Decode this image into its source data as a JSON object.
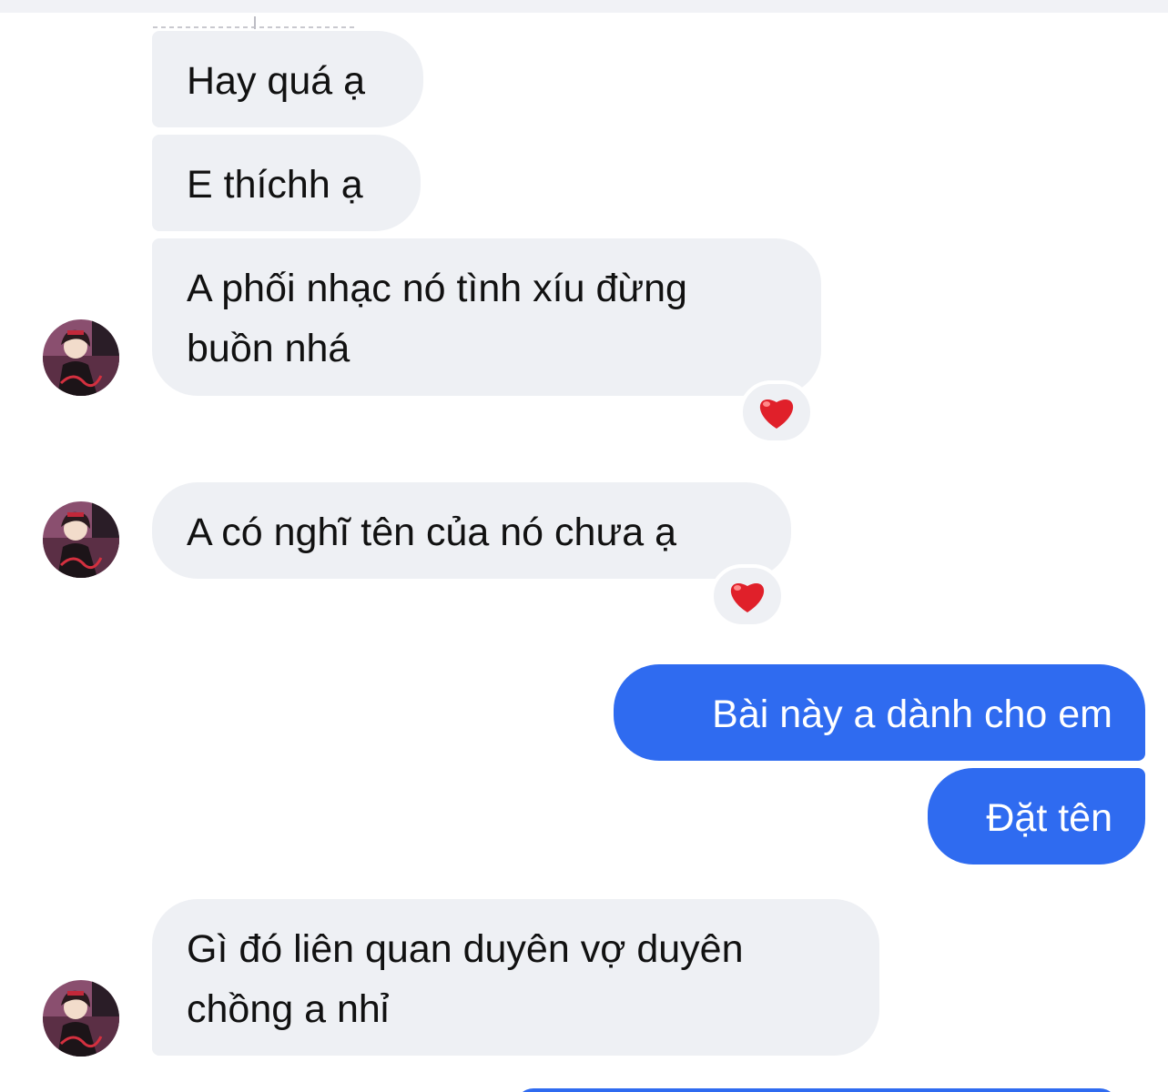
{
  "messages": [
    {
      "text": "Hay quá ạ"
    },
    {
      "text": "E thíchh ạ"
    },
    {
      "lines": [
        "A phối nhạc nó tình xíu đừng",
        "buồn nhá"
      ],
      "reaction": "heart-icon"
    },
    {
      "text": "A có nghĩ tên của nó chưa ạ",
      "reaction": "heart-icon"
    },
    {
      "text": "Bài này a dành cho em"
    },
    {
      "text": "Đặt tên"
    },
    {
      "lines": [
        "Gì đó liên quan duyên vợ duyên",
        "chồng a nhỉ"
      ]
    }
  ],
  "colors": {
    "incoming_bubble": "#eef0f4",
    "outgoing_bubble": "#2f6bf0",
    "reaction_heart": "#e0202a",
    "top_bar": "#f1f2f6"
  }
}
